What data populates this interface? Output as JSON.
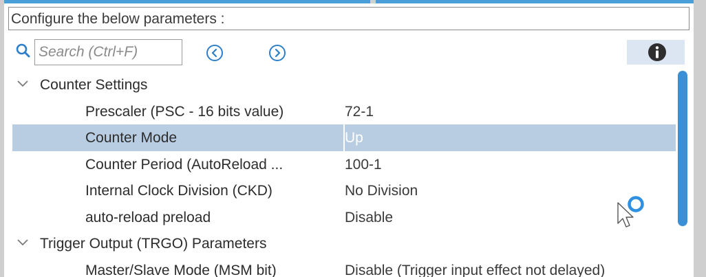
{
  "header": {
    "text": "Configure the below parameters :"
  },
  "search": {
    "placeholder": "Search (Ctrl+F)"
  },
  "toolbar": {
    "prev_icon": "chevron-left-circle-icon",
    "next_icon": "chevron-right-circle-icon",
    "info_icon": "info-icon"
  },
  "groups": [
    {
      "label": "Counter Settings",
      "expanded": true,
      "params": [
        {
          "name": "Prescaler (PSC - 16 bits value)",
          "value": "72-1"
        },
        {
          "name": "Counter Mode",
          "value": "Up",
          "selected": true
        },
        {
          "name": "Counter Period (AutoReload ...",
          "value": "100-1"
        },
        {
          "name": "Internal Clock Division (CKD)",
          "value": "No Division"
        },
        {
          "name": "auto-reload preload",
          "value": "Disable"
        }
      ]
    },
    {
      "label": "Trigger Output (TRGO) Parameters",
      "expanded": true,
      "params": [
        {
          "name": "Master/Slave Mode (MSM bit)",
          "value": "Disable (Trigger input effect not delayed)"
        }
      ]
    }
  ],
  "colors": {
    "accent": "#3b8fd4",
    "selection": "#b9cde2",
    "info_button_bg": "#dce6f2"
  }
}
